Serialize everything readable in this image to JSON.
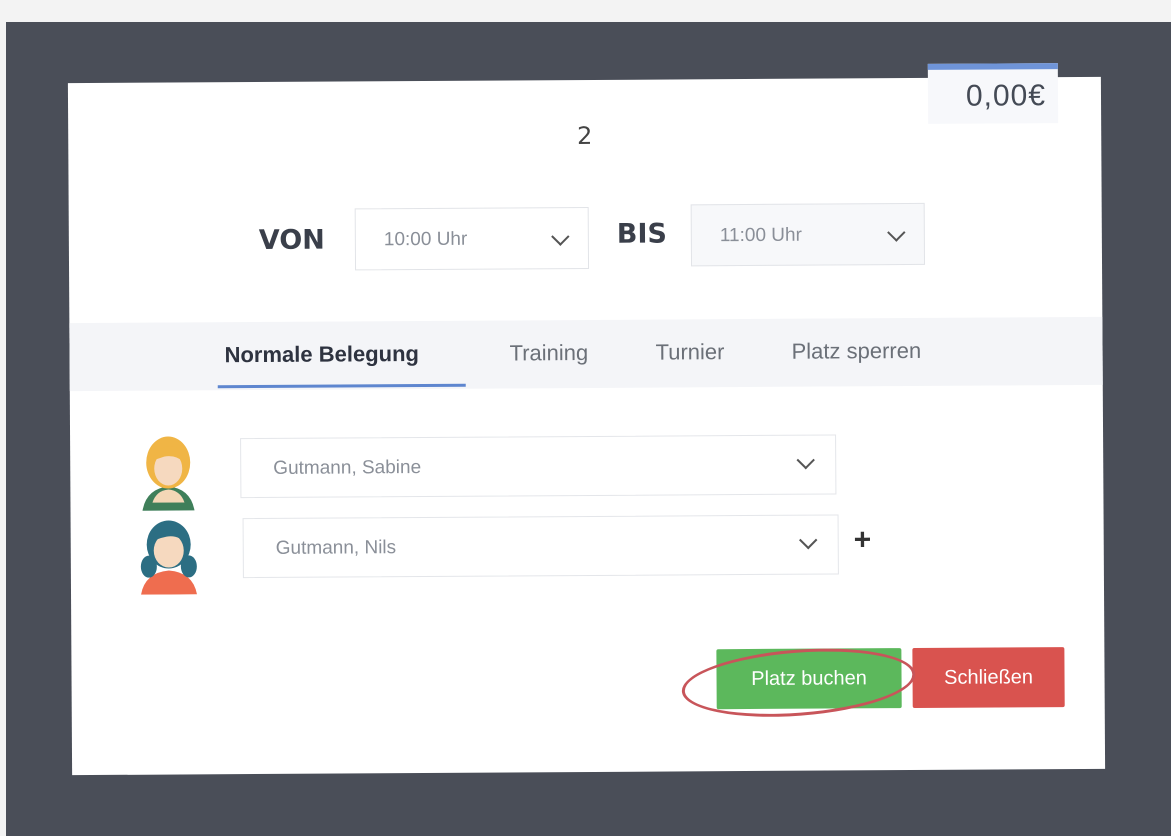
{
  "price": "0,00€",
  "court_number": "2",
  "time": {
    "from_label": "VON",
    "from_value": "10:00 Uhr",
    "to_label": "BIS",
    "to_value": "11:00 Uhr"
  },
  "tabs": [
    {
      "label": "Normale Belegung",
      "active": true
    },
    {
      "label": "Training",
      "active": false
    },
    {
      "label": "Turnier",
      "active": false
    },
    {
      "label": "Platz sperren",
      "active": false
    }
  ],
  "players": [
    {
      "name": "Gutmann, Sabine",
      "avatar": "female-avatar-icon"
    },
    {
      "name": "Gutmann, Nils",
      "avatar": "female-avatar-icon"
    }
  ],
  "buttons": {
    "book": "Platz buchen",
    "close": "Schließen"
  },
  "colors": {
    "accent": "#5e86cf",
    "book": "#5cb85c",
    "close": "#d9534f",
    "annotation_ring": "#c8555a"
  }
}
